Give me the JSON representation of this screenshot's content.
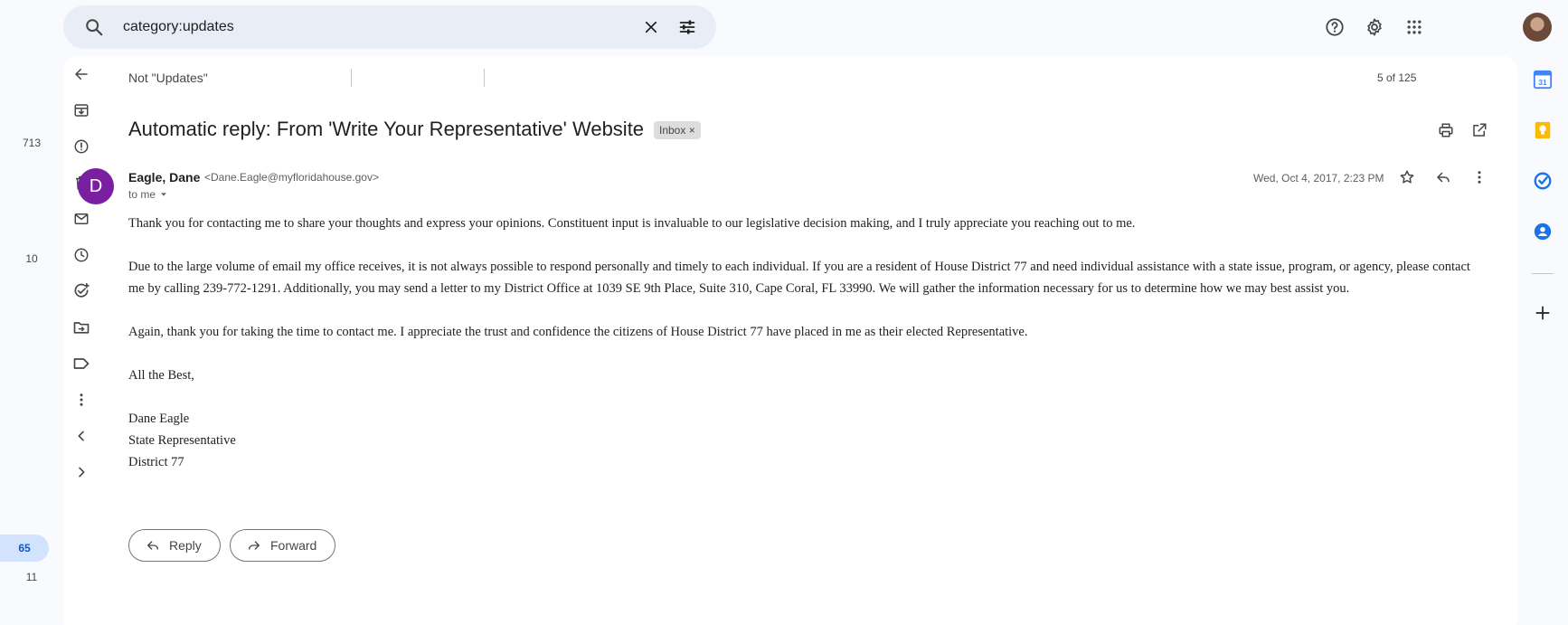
{
  "search": {
    "query": "category:updates"
  },
  "rail_counts": [
    "713",
    "10",
    "65",
    "11"
  ],
  "toolbar": {
    "not_updates_label": "Not \"Updates\"",
    "pager": "5 of 125"
  },
  "email": {
    "subject": "Automatic reply: From 'Write Your Representative' Website",
    "label": "Inbox",
    "label_remove": "×",
    "sender_initial": "D",
    "sender_name": "Eagle, Dane",
    "sender_email": "<Dane.Eagle@myfloridahouse.gov>",
    "recipient": "to me",
    "date": "Wed, Oct 4, 2017, 2:23 PM",
    "paragraphs": [
      "Thank you for contacting me to share your thoughts and express your opinions. Constituent input is invaluable to our legislative decision making, and I truly appreciate you reaching out to me.",
      "Due to the large volume of email my office receives, it is not always possible to respond personally and timely to each individual. If you are a resident of House District 77 and need individual assistance with a state issue, program, or agency, please contact me by calling 239-772-1291. Additionally, you may send a letter to my District Office at 1039 SE 9th Place, Suite 310, Cape Coral, FL 33990. We will gather the information necessary for us to determine how we may best assist you.",
      "Again, thank you for taking the time to contact me. I appreciate the trust and confidence the citizens of House District 77 have placed in me as their elected Representative.",
      "All the Best,"
    ],
    "signature": [
      "Dane Eagle",
      "State Representative",
      "District 77"
    ]
  },
  "actions": {
    "reply": "Reply",
    "forward": "Forward"
  },
  "side_panel": {
    "calendar_day": "31"
  },
  "colors": {
    "accent": "#0b57d0",
    "avatar": "#7b1fa2",
    "keep": "#fbbc04",
    "tasks": "#1a73e8"
  }
}
